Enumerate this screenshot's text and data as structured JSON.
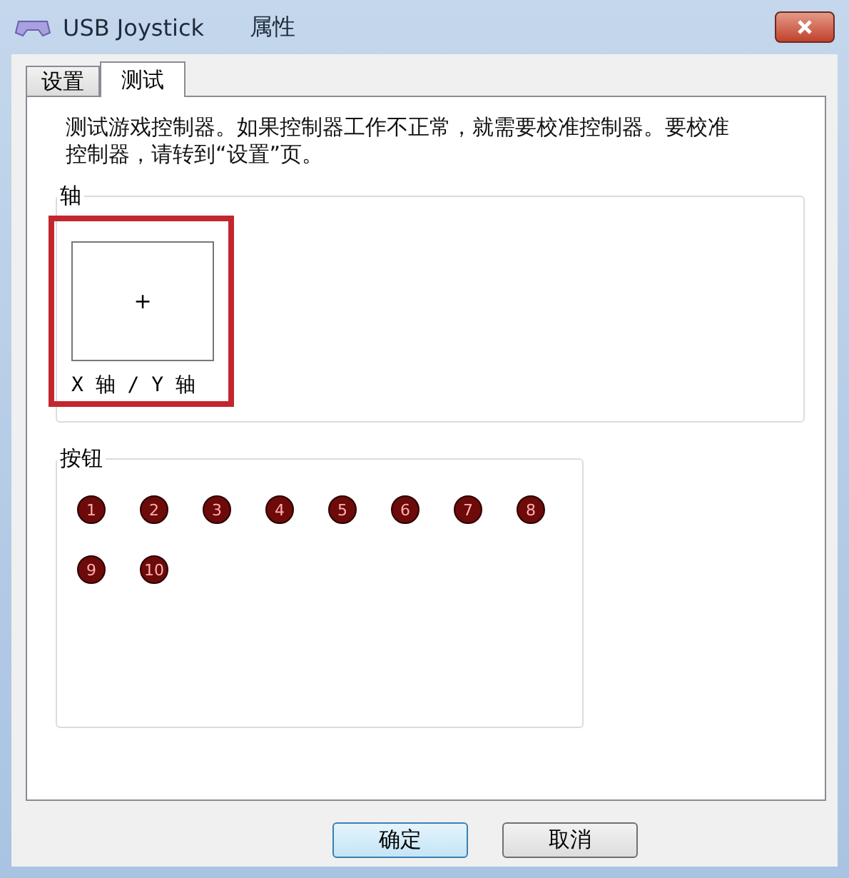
{
  "window": {
    "title": "USB Joystick",
    "subtitle": "属性"
  },
  "tabs": [
    {
      "label": "设置",
      "selected": false
    },
    {
      "label": "测试",
      "selected": true
    }
  ],
  "description": "测试游戏控制器。如果控制器工作不正常，就需要校准控制器。要校准控制器，请转到“设置”页。",
  "axes": {
    "title": "轴",
    "highlighted": true,
    "pad_marker": "+",
    "label": "X 轴 / Y 轴"
  },
  "buttons_group": {
    "title": "按钮",
    "buttons": [
      {
        "label": "1",
        "pressed": false
      },
      {
        "label": "2",
        "pressed": false
      },
      {
        "label": "3",
        "pressed": false
      },
      {
        "label": "4",
        "pressed": false
      },
      {
        "label": "5",
        "pressed": false
      },
      {
        "label": "6",
        "pressed": false
      },
      {
        "label": "7",
        "pressed": false
      },
      {
        "label": "8",
        "pressed": false
      },
      {
        "label": "9",
        "pressed": false
      },
      {
        "label": "10",
        "pressed": false
      }
    ]
  },
  "dialog_buttons": [
    {
      "label": "确定",
      "default": true
    },
    {
      "label": "取消",
      "default": false
    }
  ]
}
